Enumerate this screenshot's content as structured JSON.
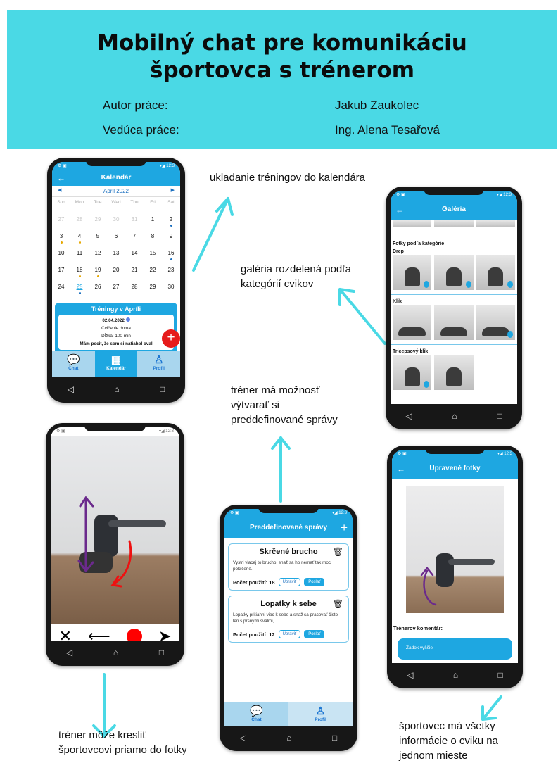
{
  "header": {
    "title_line1": "Mobilný chat pre komunikáciu",
    "title_line2": "športovca s trénerom",
    "author_label": "Autor práce:",
    "author_value": "Jakub Zaukolec",
    "supervisor_label": "Vedúca práce:",
    "supervisor_value": "Ing. Alena Tesařová"
  },
  "notes": {
    "calendar": "ukladanie tréningov do kalendára",
    "gallery": "galéria rozdelená podľa kategórií cvikov",
    "predefined": "tréner má možnosť výtvarať si preddefinované správy",
    "draw": "tréner môže kresliť športovcovi priamo do fotky",
    "info": "športovec má všetky informácie o cviku na jednom mieste"
  },
  "calendar_screen": {
    "title": "Kalendár",
    "month": "April 2022",
    "weekdays": [
      "Sun",
      "Mon",
      "Tue",
      "Wed",
      "Thu",
      "Fri",
      "Sat"
    ],
    "days": [
      "27",
      "28",
      "29",
      "30",
      "31",
      "1",
      "2",
      "3",
      "4",
      "5",
      "6",
      "7",
      "8",
      "9",
      "10",
      "11",
      "12",
      "13",
      "14",
      "15",
      "16",
      "17",
      "18",
      "19",
      "20",
      "21",
      "22",
      "23",
      "24",
      "25",
      "26",
      "27",
      "28",
      "29",
      "30"
    ],
    "panel_title": "Tréningy v Apríli",
    "entry_date": "02.04.2022",
    "entry_name": "Cvičenie doma",
    "entry_length": "Dĺžka: 100 min",
    "entry_feel": "Mám pocit, že som si natiahol oval",
    "tabs": [
      "Chat",
      "Kalendár",
      "Profil"
    ]
  },
  "gallery_screen": {
    "title": "Galéria",
    "section": "Fotky podľa kategórie",
    "categories": [
      "Drep",
      "Klik",
      "Tricepsový klik"
    ]
  },
  "predefined_screen": {
    "title": "Preddefinované správy",
    "cards": [
      {
        "title": "Skrčené brucho",
        "body": "Vystri viacej to brucho, snaž sa ho nemať tak moc pokrčené.",
        "count": "Počet použití: 18"
      },
      {
        "title": "Lopatky k sebe",
        "body": "Lopatky pritiahni viac k sebe a snaž sa pracovať čisto len s prsnými svalmi, ...",
        "count": "Počet použití: 12"
      }
    ],
    "edit_label": "Upraviť",
    "send_label": "Poslať",
    "tabs": [
      "Chat",
      "Profil"
    ]
  },
  "edited_screen": {
    "title": "Upravené fotky",
    "comment_label": "Trénerov komentár:",
    "comment_text": "Zadok vyššie"
  },
  "colors": {
    "accent": "#1ea7e1",
    "header": "#4ad9e5",
    "arrow": "#4ad9e5",
    "red": "#e61b1b"
  }
}
